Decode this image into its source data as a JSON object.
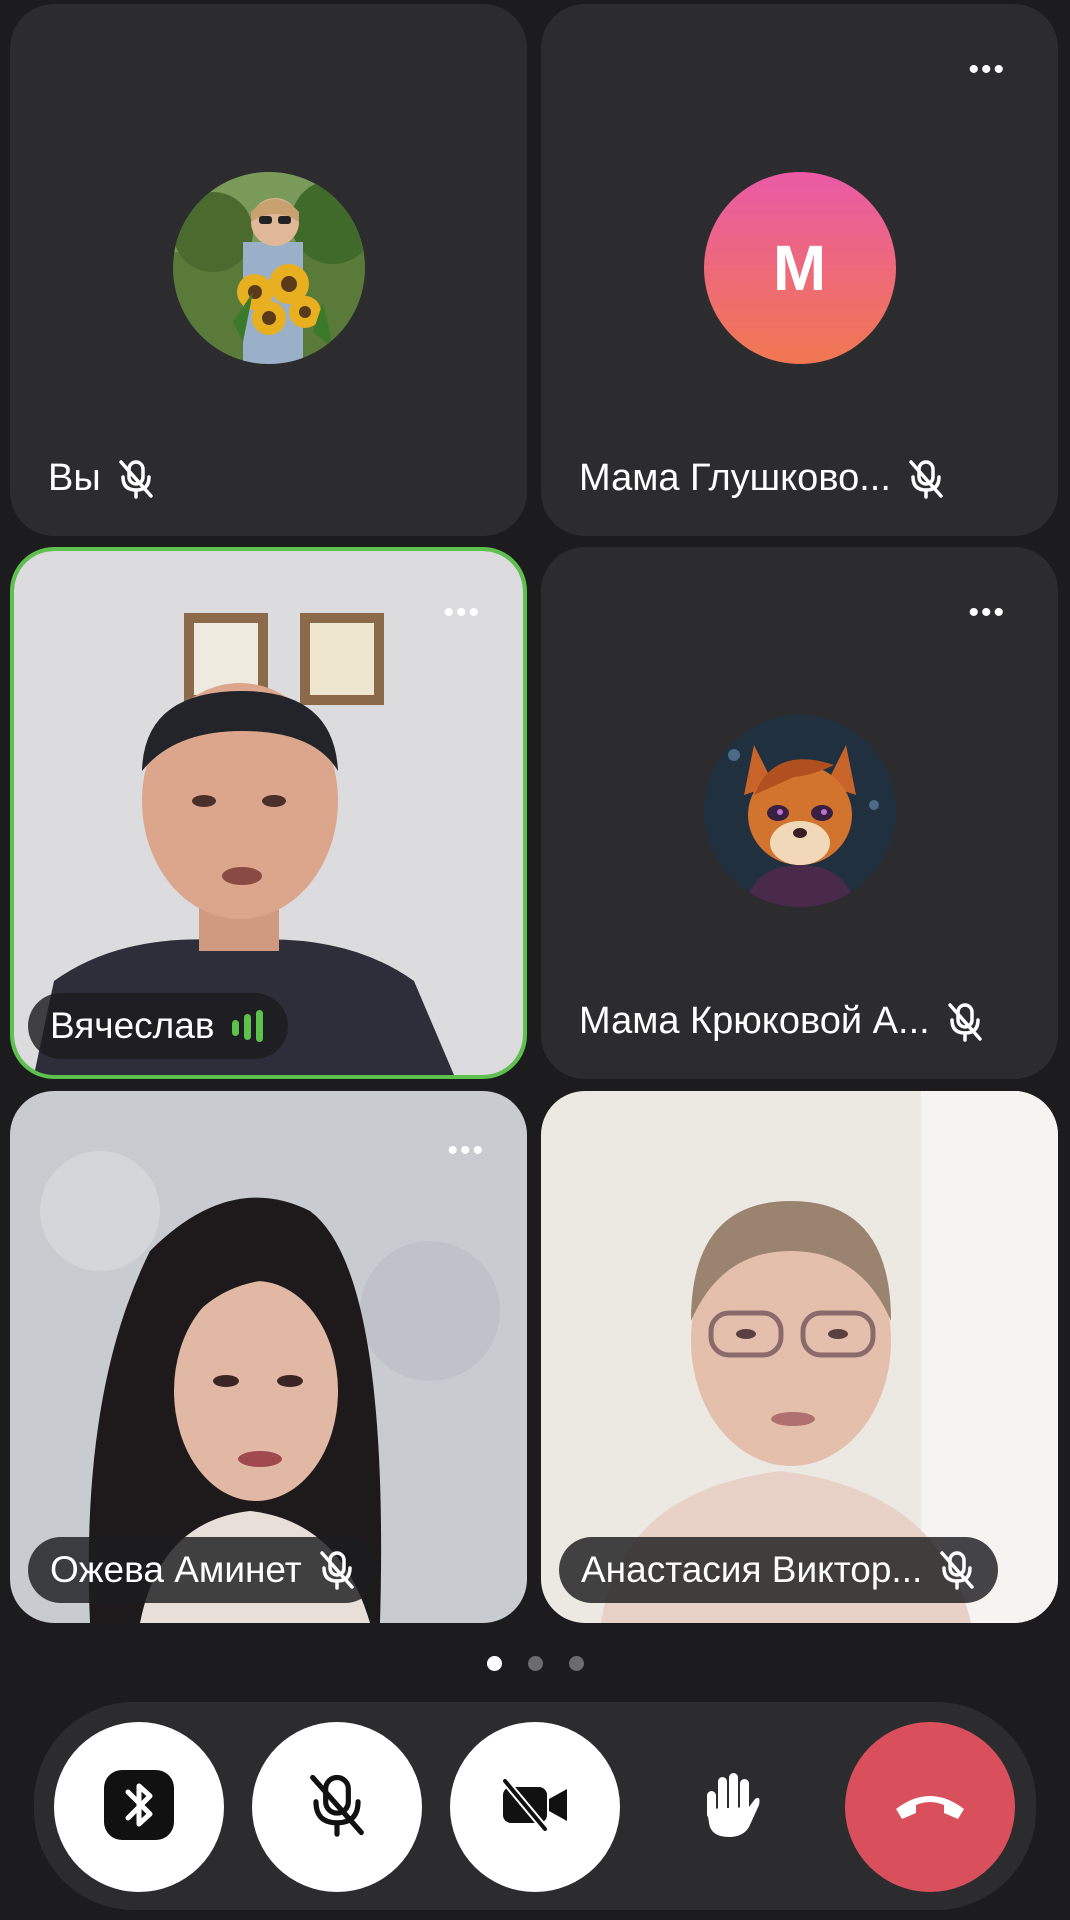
{
  "participants": [
    {
      "name": "Вы",
      "avatar": "photo-sunflowers",
      "muted": true
    },
    {
      "name": "Мама Глушково...",
      "avatar_letter": "M",
      "muted": true
    },
    {
      "name": "Вячеслав",
      "video": true,
      "speaking": true
    },
    {
      "name": "Мама Крюковой А...",
      "avatar": "fox-character",
      "muted": true
    },
    {
      "name": "Ожева Аминет",
      "video": true,
      "muted": true
    },
    {
      "name": "Анастасия Виктор...",
      "video": true,
      "muted": true
    }
  ],
  "more_label": "•••",
  "pager": {
    "pages": 3,
    "current": 1
  },
  "controls": [
    {
      "name": "bluetooth-audio",
      "icon": "bluetooth-icon"
    },
    {
      "name": "microphone-toggle",
      "icon": "mic-off-icon"
    },
    {
      "name": "camera-toggle",
      "icon": "video-off-icon"
    },
    {
      "name": "raise-hand",
      "icon": "hand-icon"
    },
    {
      "name": "end-call",
      "icon": "phone-hangup-icon"
    }
  ],
  "colors": {
    "speaking_border": "#5cc24c",
    "end_call": "#d9505c",
    "avatar_gradient": [
      "#ea5aa6",
      "#f07850"
    ]
  }
}
